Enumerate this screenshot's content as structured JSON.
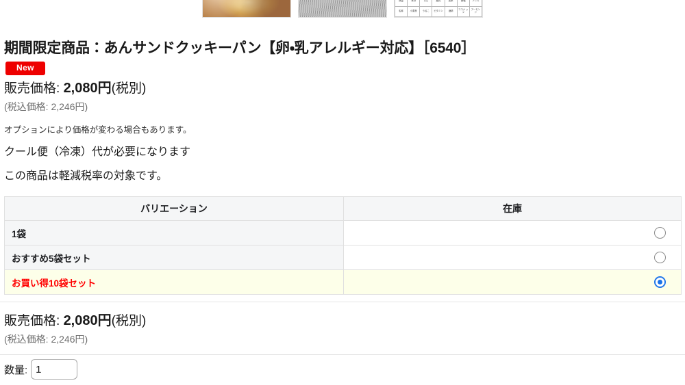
{
  "gallery": {
    "thumbnails": [
      {
        "name": "product-photo-bread",
        "alt": "あんサンドクッキーパン断面写真"
      },
      {
        "name": "product-photo-tray",
        "alt": "商品トレイ写真"
      },
      {
        "name": "product-nutrition-table",
        "alt": "原材料・栄養成分表"
      }
    ],
    "nutrition_thumb_rows": [
      [
        "熱量",
        "水分",
        "たん",
        "脂質",
        "炭水",
        "食塩",
        "アレル"
      ],
      [
        "名称",
        "小麦粉",
        "うるこ",
        "ピタミン",
        "酒精",
        "ココナ\nッツ",
        "アーモン\nド"
      ]
    ]
  },
  "product": {
    "title": "期間限定商品：あんサンドクッキーパン【卵・乳アレルギー対応】［6540］",
    "new_badge": "New"
  },
  "price": {
    "label": "販売価格:",
    "amount": "2,080円",
    "tax_note": "(税別)",
    "tax_included": "(税込価格: 2,246円)"
  },
  "notes": {
    "option": "オプションにより価格が変わる場合もあります。",
    "cool_delivery": "クール便（冷凍）代が必要になります",
    "reduced_tax": "この商品は軽減税率の対象です。"
  },
  "variation_table": {
    "headers": {
      "variation": "バリエーション",
      "stock": "在庫"
    },
    "rows": [
      {
        "name": "1袋",
        "selected": false
      },
      {
        "name": "おすすめ5袋セット",
        "selected": false
      },
      {
        "name": "お買い得10袋セット",
        "selected": true
      }
    ]
  },
  "quantity": {
    "label": "数量:",
    "value": "1"
  },
  "colors": {
    "badge_red": "#ee0000",
    "selected_row_bg": "#fdffe9",
    "selected_row_text": "#ff0000",
    "radio_checked": "#1a73e8",
    "header_bg": "#f5f6f7"
  }
}
